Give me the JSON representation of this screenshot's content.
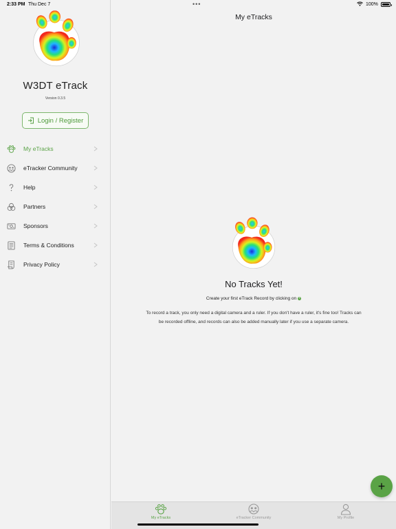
{
  "status_bar": {
    "time": "2:33 PM",
    "date": "Thu Dec 7",
    "battery": "100%",
    "icons": [
      "wifi-icon",
      "battery-icon"
    ]
  },
  "sidebar": {
    "app_title": "W3DT eTrack",
    "version": "Version 0.3.5",
    "login_label": "Login / Register",
    "accent_color": "#5aa346",
    "items": [
      {
        "label": "My eTracks",
        "icon": "paw-icon",
        "active": true
      },
      {
        "label": "eTracker Community",
        "icon": "community-icon",
        "active": false
      },
      {
        "label": "Help",
        "icon": "question-icon",
        "active": false
      },
      {
        "label": "Partners",
        "icon": "partners-icon",
        "active": false
      },
      {
        "label": "Sponsors",
        "icon": "sponsors-icon",
        "active": false
      },
      {
        "label": "Terms & Conditions",
        "icon": "document-icon",
        "active": false
      },
      {
        "label": "Privacy Policy",
        "icon": "policy-icon",
        "active": false
      }
    ]
  },
  "main": {
    "nav_title": "My eTracks",
    "empty_title": "No Tracks Yet!",
    "empty_cta": "Create your first eTrack Record by clicking on",
    "empty_description": "To record a track, you only need a digital camera and a ruler. If you don't have a ruler, it's fine too! Tracks can be recorded offline, and records can also be added manually later if you use a separate camera.",
    "fab_label": "+"
  },
  "tab_bar": {
    "tabs": [
      {
        "label": "My eTracks",
        "icon": "paw-icon",
        "active": true
      },
      {
        "label": "eTracker Community",
        "icon": "community-icon",
        "active": false
      },
      {
        "label": "My Profile",
        "icon": "person-icon",
        "active": false
      }
    ]
  }
}
